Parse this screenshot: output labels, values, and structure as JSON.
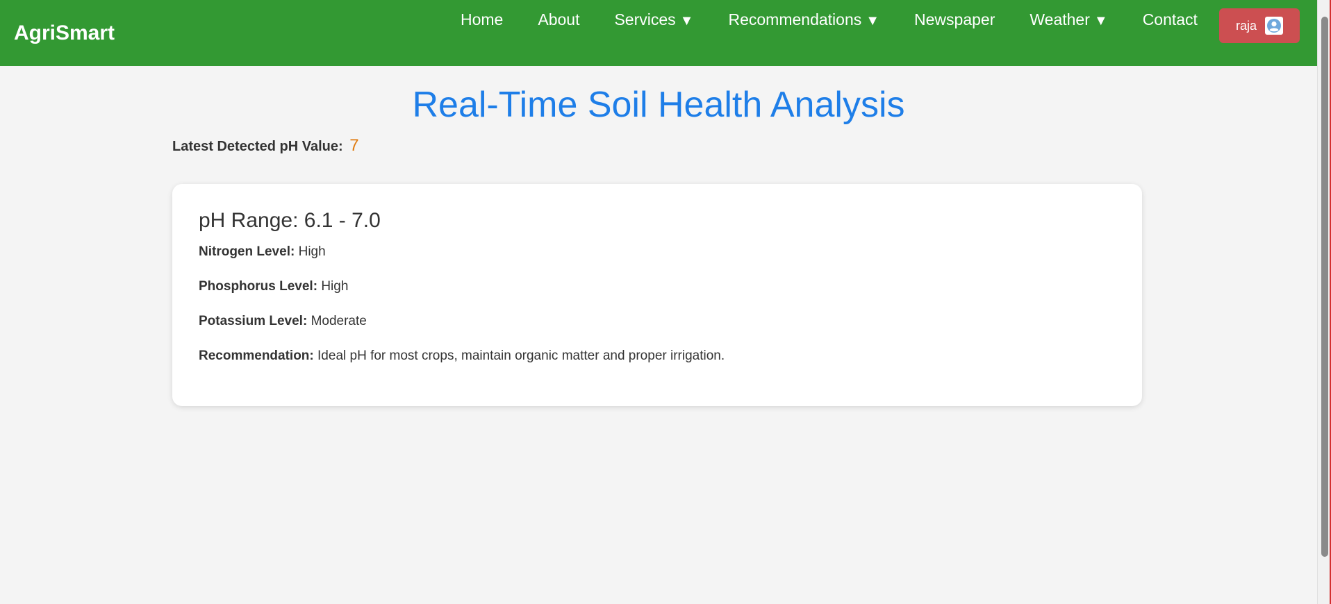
{
  "brand": "AgriSmart",
  "nav": {
    "items": [
      {
        "label": "Home",
        "caret": ""
      },
      {
        "label": "About",
        "caret": ""
      },
      {
        "label": "Services",
        "caret": "▼"
      },
      {
        "label": "Recommendations",
        "caret": "▼"
      },
      {
        "label": "Newspaper",
        "caret": ""
      },
      {
        "label": "Weather",
        "caret": "▼"
      },
      {
        "label": "Contact",
        "caret": ""
      }
    ],
    "user": {
      "name": "raja",
      "icon": "user-avatar-icon"
    }
  },
  "main": {
    "title": "Real-Time Soil Health Analysis",
    "ph_label": "Latest Detected pH Value:",
    "ph_value": "7"
  },
  "card": {
    "title": "pH Range: 6.1 - 7.0",
    "rows": [
      {
        "label": "Nitrogen Level:",
        "value": "High"
      },
      {
        "label": "Phosphorus Level:",
        "value": "High"
      },
      {
        "label": "Potassium Level:",
        "value": "Moderate"
      },
      {
        "label": "Recommendation:",
        "value": "Ideal pH for most crops, maintain organic matter and proper irrigation."
      }
    ]
  },
  "colors": {
    "navbar": "#339933",
    "user_button": "#cc4f51",
    "title": "#1e7ee8",
    "ph_value": "#e07b10",
    "background": "#f4f4f4"
  }
}
